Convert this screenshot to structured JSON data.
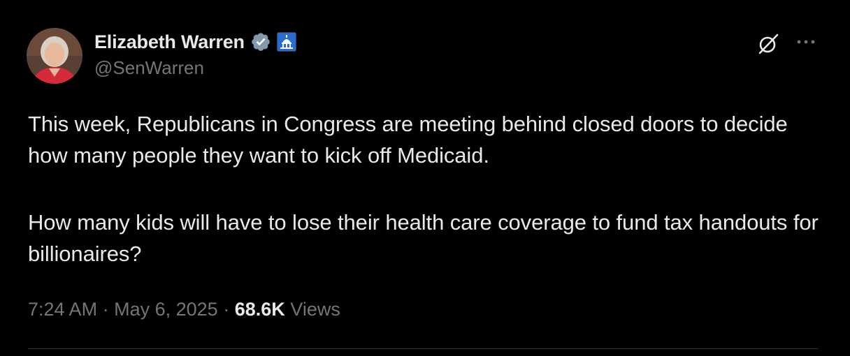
{
  "author": {
    "display_name": "Elizabeth Warren",
    "handle": "@SenWarren",
    "verified_icon": "verified-badge-icon",
    "affiliation_icon": "capitol-icon"
  },
  "toolbar": {
    "grok_icon": "grok-icon",
    "more_icon": "more-options-icon"
  },
  "tweet": {
    "paragraphs": [
      "This week, Republicans in Congress are meeting behind closed doors to decide how many people they want to kick off Medicaid.",
      "How many kids will have to lose their health care coverage to fund tax handouts for billionaires?"
    ]
  },
  "meta": {
    "time": "7:24 AM",
    "separator": "·",
    "date": "May 6, 2025",
    "views_count": "68.6K",
    "views_label": "Views"
  },
  "colors": {
    "background": "#000000",
    "text_primary": "#e7e9ea",
    "text_secondary": "#71767b",
    "verified_badge": "#829aab",
    "divider": "#2f3336"
  }
}
